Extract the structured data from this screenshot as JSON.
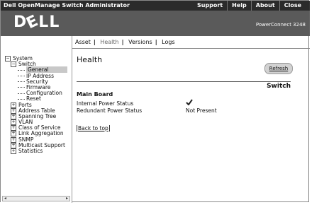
{
  "topbar": {
    "title": "Dell OpenManage Switch Administrator",
    "menu": [
      "Support",
      "Help",
      "About",
      "Close"
    ]
  },
  "brand": {
    "logo": "DELL",
    "model": "PowerConnect 3248"
  },
  "nav": {
    "items": [
      "Asset",
      "Health",
      "Versions",
      "Logs"
    ],
    "active": "Health"
  },
  "tree": {
    "system": "System",
    "switch": "Switch",
    "switch_children": [
      "General",
      "IP Address",
      "Security",
      "Firmware",
      "Configuration",
      "Reset"
    ],
    "others": [
      "Ports",
      "Address Table",
      "Spanning Tree",
      "VLAN",
      "Class of Service",
      "Link Aggregation",
      "SNMP",
      "Multicast Support",
      "Statistics"
    ]
  },
  "main": {
    "title": "Health",
    "refresh_label": "Refresh",
    "section_label": "Switch",
    "board_title": "Main Board",
    "rows": [
      {
        "label": "Internal Power Status",
        "value": ""
      },
      {
        "label": "Redundant Power Status",
        "value": "Not Present"
      }
    ],
    "back_link": "Back to top"
  }
}
